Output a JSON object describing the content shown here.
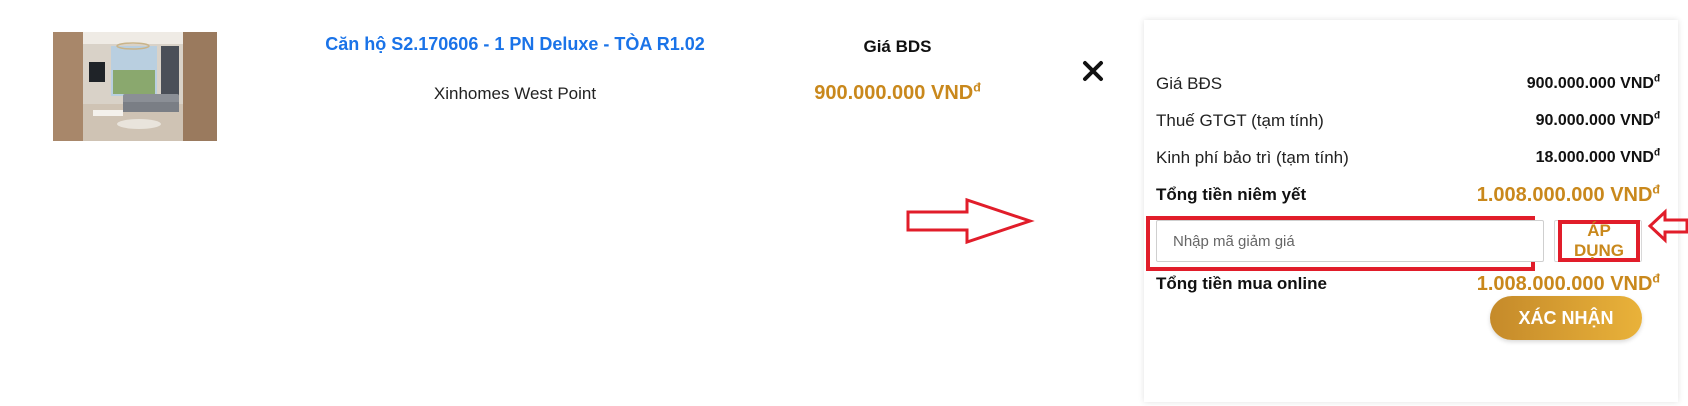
{
  "product": {
    "name": "Căn hộ S2.170606 - 1 PN Deluxe - TÒA R1.02",
    "project": "Xinhomes West Point",
    "price_label": "Giá BDS",
    "price_value": "900.000.000 VND",
    "currency_symbol": "đ",
    "thumbnail_icon": "apartment-living-room-photo",
    "remove_icon": "close-icon"
  },
  "summary": {
    "rows": [
      {
        "label": "Giá BĐS",
        "value": "900.000.000 VND",
        "symbol": "đ"
      },
      {
        "label": "Thuế GTGT (tạm tính)",
        "value": "90.000.000 VND",
        "symbol": "đ"
      },
      {
        "label": "Kinh phí bảo trì (tạm tính)",
        "value": "18.000.000 VND",
        "symbol": "đ"
      }
    ],
    "listed_total": {
      "label": "Tổng tiền niêm yết",
      "value": "1.008.000.000 VND",
      "symbol": "đ"
    },
    "coupon": {
      "placeholder": "Nhập mã giảm giá",
      "value": "",
      "apply_label": "ÁP DỤNG"
    },
    "online_total": {
      "label": "Tổng tiền mua online",
      "value": "1.008.000.000 VND",
      "symbol": "đ"
    },
    "confirm_label": "XÁC NHẬN"
  },
  "colors": {
    "link_blue": "#1a73e8",
    "price_gold": "#c9881c",
    "annotation_red": "#e11d2a"
  }
}
